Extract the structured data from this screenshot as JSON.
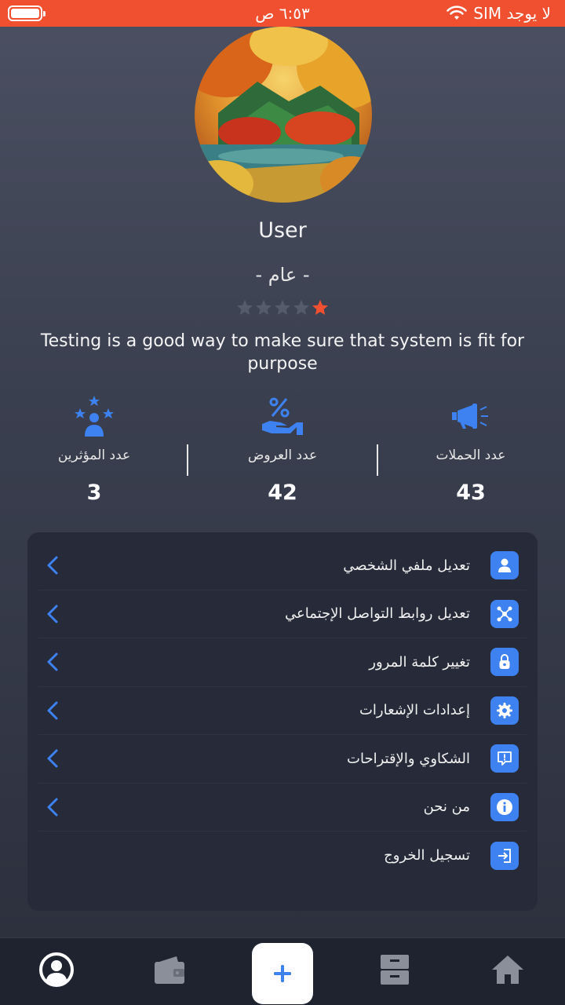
{
  "status_bar": {
    "carrier": "لا يوجد SIM",
    "time": "٦:٥٣ ص",
    "battery_level": 1.0
  },
  "profile": {
    "name": "User",
    "type": "-  عام  -",
    "rating": 1,
    "rating_max": 5,
    "bio": "Testing is a good way to make sure that system is fit for purpose"
  },
  "stats": [
    {
      "label": "عدد الحملات",
      "value": "43",
      "icon": "megaphone-icon"
    },
    {
      "label": "عدد العروض",
      "value": "42",
      "icon": "percent-hand-icon"
    },
    {
      "label": "عدد المؤثرين",
      "value": "3",
      "icon": "influencers-icon"
    }
  ],
  "menu": [
    {
      "label": "تعديل ملفي الشخصي",
      "icon": "user-icon"
    },
    {
      "label": "تعديل روابط التواصل الإجتماعي",
      "icon": "network-icon"
    },
    {
      "label": "تغيير كلمة المرور",
      "icon": "lock-icon"
    },
    {
      "label": "إعدادات الإشعارات",
      "icon": "gear-icon"
    },
    {
      "label": "الشكاوي والإقتراحات",
      "icon": "feedback-icon"
    },
    {
      "label": "من نحن",
      "icon": "info-icon"
    },
    {
      "label": "تسجيل الخروج",
      "icon": "logout-icon"
    }
  ],
  "tab_bar": {
    "items": [
      "profile-icon",
      "wallet-icon",
      "add-icon",
      "archive-icon",
      "home-icon"
    ],
    "active": "profile-icon"
  },
  "colors": {
    "accent": "#3d82f0",
    "status_bar": "#f0502f",
    "star_active": "#f0502f",
    "card": "#272b39"
  }
}
